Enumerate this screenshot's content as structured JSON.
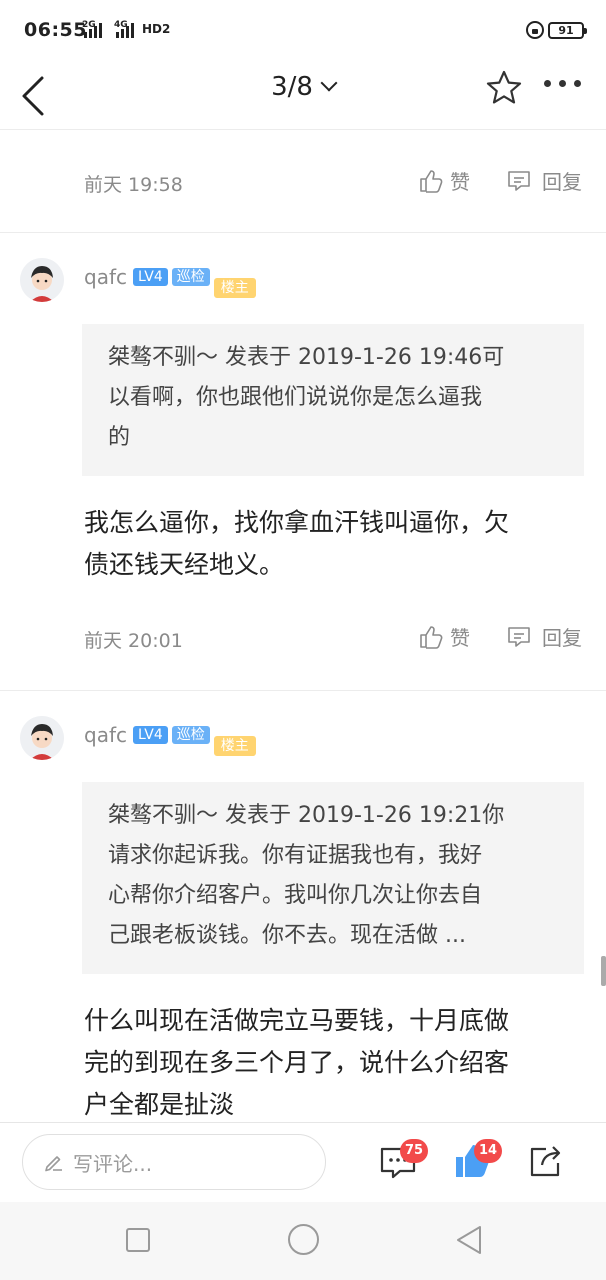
{
  "status_bar": {
    "time": "06:55",
    "signal1_label": "2G",
    "signal2_label": "4G",
    "hd_label": "HD2",
    "battery": "91"
  },
  "nav": {
    "page_indicator": "3/8"
  },
  "prev_post_footer": {
    "time": "前天 19:58",
    "like_label": "赞",
    "reply_label": "回复"
  },
  "posts": [
    {
      "username": "qafc",
      "level_badge": "LV4",
      "role_badge": "巡检",
      "owner_badge": "楼主",
      "quote_lines": [
        "桀骜不驯〜 发表于 2019-1-26 19:46可",
        "以看啊，你也跟他们说说你是怎么逼我",
        "的"
      ],
      "body_lines": [
        "我怎么逼你，找你拿血汗钱叫逼你，欠",
        "债还钱天经地义。"
      ],
      "time": "前天 20:01",
      "like_label": "赞",
      "reply_label": "回复"
    },
    {
      "username": "qafc",
      "level_badge": "LV4",
      "role_badge": "巡检",
      "owner_badge": "楼主",
      "quote_lines": [
        "桀骜不驯〜 发表于 2019-1-26 19:21你",
        "请求你起诉我。你有证据我也有，我好",
        "心帮你介绍客户。我叫你几次让你去自",
        "己跟老板谈钱。你不去。现在活做 ..."
      ],
      "body_lines": [
        "什么叫现在活做完立马要钱，十月底做",
        "完的到现在多三个月了，说什么介绍客",
        "户全都是扯淡"
      ]
    }
  ],
  "bottom_bar": {
    "comment_placeholder": "写评论...",
    "comment_count": "75",
    "like_count": "14"
  },
  "colors": {
    "accent_blue": "#4b9ff5",
    "badge_red": "#f24a4a",
    "owner_yellow": "#ffd470"
  }
}
